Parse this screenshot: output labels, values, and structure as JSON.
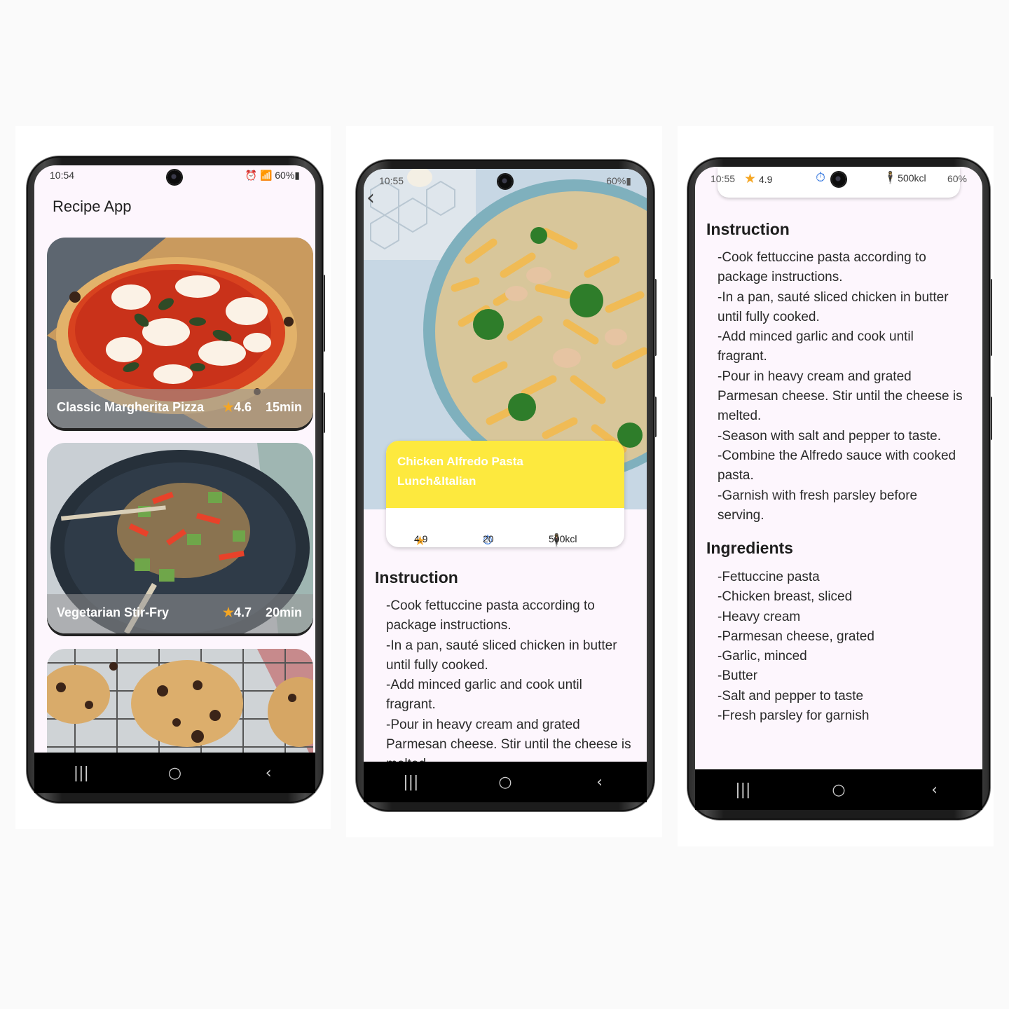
{
  "screen1": {
    "status": {
      "time": "10:54",
      "icons": "⏰ 📶 60%▮"
    },
    "app_title": "Recipe App",
    "recipes": [
      {
        "name": "Classic Margherita Pizza",
        "rating": "4.6",
        "duration": "15min"
      },
      {
        "name": "Vegetarian Stir-Fry",
        "rating": "4.7",
        "duration": "20min"
      }
    ],
    "nav": {
      "recent": "|||",
      "home": "○",
      "back": "‹"
    }
  },
  "screen2": {
    "status": {
      "time": "10:55",
      "icons": "60%▮"
    },
    "back_icon": "‹",
    "recipe_title": "Chicken Alfredo Pasta",
    "recipe_tags": "Lunch&Italian",
    "rating": "4.9",
    "time": "20",
    "calories": "500kcl",
    "instruction_title": "Instruction",
    "instruction_lines": [
      "-Cook fettuccine pasta according to",
      "package instructions.",
      "-In a pan, sauté sliced chicken in butter",
      "until fully cooked.",
      "-Add minced garlic and cook until",
      "fragrant.",
      "-Pour in heavy cream and grated",
      "Parmesan cheese. Stir until the cheese is",
      "melted."
    ],
    "nav": {
      "recent": "|||",
      "home": "○",
      "back": "‹"
    }
  },
  "screen3": {
    "status": {
      "time": "10:55",
      "rating": "4.9",
      "calories": "500kcl",
      "battery": "60%"
    },
    "instruction_title": "Instruction",
    "instruction_lines": [
      "-Cook fettuccine pasta according to",
      "package instructions.",
      "-In a pan, sauté sliced chicken in butter",
      "until fully cooked.",
      "-Add minced garlic and cook until",
      "fragrant.",
      "-Pour in heavy cream and grated",
      "Parmesan cheese. Stir until the cheese is",
      "melted.",
      "-Season with salt and pepper to taste.",
      "-Combine the Alfredo sauce with cooked",
      "pasta.",
      "-Garnish with fresh parsley before",
      "serving."
    ],
    "ingredients_title": "Ingredients",
    "ingredient_lines": [
      "-Fettuccine pasta",
      "-Chicken breast, sliced",
      "-Heavy cream",
      "-Parmesan cheese, grated",
      "-Garlic, minced",
      "-Butter",
      "-Salt and pepper to taste",
      "-Fresh parsley for garnish"
    ],
    "nav": {
      "recent": "|||",
      "home": "○",
      "back": "‹"
    }
  }
}
